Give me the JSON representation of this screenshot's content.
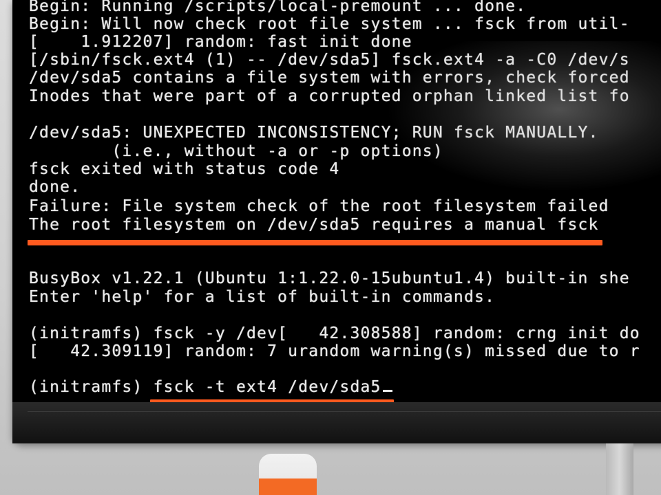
{
  "terminal": {
    "lines": [
      "Begin: Running /scripts/local-premount ... done.",
      "Begin: Will now check root file system ... fsck from util-",
      "[    1.912207] random: fast init done",
      "[/sbin/fsck.ext4 (1) -- /dev/sda5] fsck.ext4 -a -C0 /dev/s",
      "/dev/sda5 contains a file system with errors, check forced",
      "Inodes that were part of a corrupted orphan linked list fo",
      "",
      "/dev/sda5: UNEXPECTED INCONSISTENCY; RUN fsck MANUALLY.",
      "        (i.e., without -a or -p options)",
      "fsck exited with status code 4",
      "done.",
      "Failure: File system check of the root filesystem failed",
      "The root filesystem on /dev/sda5 requires a manual fsck",
      "",
      "",
      "BusyBox v1.22.1 (Ubuntu 1:1.22.0-15ubuntu1.4) built-in she",
      "Enter 'help' for a list of built-in commands.",
      "",
      "(initramfs) fsck -y /dev[   42.308588] random: crng init do",
      "[   42.309119] random: 7 urandom warning(s) missed due to r",
      "",
      "(initramfs) fsck -t ext4 /dev/sda5"
    ]
  },
  "colors": {
    "terminal_bg": "#000000",
    "terminal_text": "#eaeaea",
    "highlight": "#ff5a1f"
  },
  "icons": {
    "cursor": "text-cursor-underscore"
  }
}
